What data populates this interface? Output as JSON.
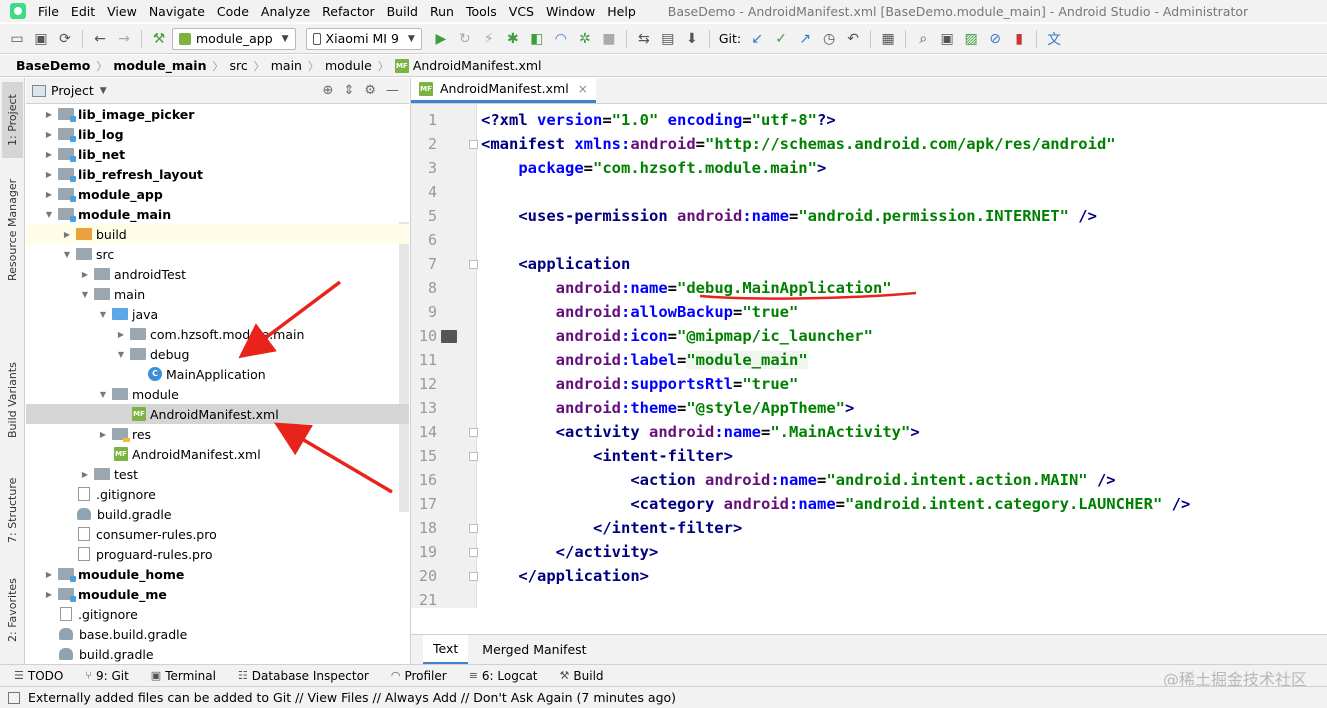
{
  "menu": [
    "File",
    "Edit",
    "View",
    "Navigate",
    "Code",
    "Analyze",
    "Refactor",
    "Build",
    "Run",
    "Tools",
    "VCS",
    "Window",
    "Help"
  ],
  "window_title": "BaseDemo - AndroidManifest.xml [BaseDemo.module_main] - Android Studio - Administrator",
  "toolbar": {
    "run_config": "module_app",
    "device": "Xiaomi MI 9",
    "git_label": "Git:"
  },
  "breadcrumb": [
    "BaseDemo",
    "module_main",
    "src",
    "main",
    "module",
    "AndroidManifest.xml"
  ],
  "left_stripe": [
    "1: Project",
    "Resource Manager",
    "Build Variants",
    "7: Structure",
    "2: Favorites"
  ],
  "project_panel": {
    "title": "Project"
  },
  "tree": [
    {
      "label": "lib_image_picker",
      "depth": 1,
      "icon": "module",
      "bold": true,
      "arrow": "right"
    },
    {
      "label": "lib_log",
      "depth": 1,
      "icon": "module",
      "bold": true,
      "arrow": "right"
    },
    {
      "label": "lib_net",
      "depth": 1,
      "icon": "module",
      "bold": true,
      "arrow": "right"
    },
    {
      "label": "lib_refresh_layout",
      "depth": 1,
      "icon": "module",
      "bold": true,
      "arrow": "right"
    },
    {
      "label": "module_app",
      "depth": 1,
      "icon": "module",
      "bold": true,
      "arrow": "right"
    },
    {
      "label": "module_main",
      "depth": 1,
      "icon": "module",
      "bold": true,
      "arrow": "down"
    },
    {
      "label": "build",
      "depth": 2,
      "icon": "folder-orange",
      "bold": false,
      "arrow": "right",
      "highlight": "yellow"
    },
    {
      "label": "src",
      "depth": 2,
      "icon": "folder",
      "bold": false,
      "arrow": "down"
    },
    {
      "label": "androidTest",
      "depth": 3,
      "icon": "folder",
      "bold": false,
      "arrow": "right"
    },
    {
      "label": "main",
      "depth": 3,
      "icon": "folder",
      "bold": false,
      "arrow": "down"
    },
    {
      "label": "java",
      "depth": 4,
      "icon": "folder-blue",
      "bold": false,
      "arrow": "down"
    },
    {
      "label": "com.hzsoft.module.main",
      "depth": 5,
      "icon": "folder",
      "bold": false,
      "arrow": "right"
    },
    {
      "label": "debug",
      "depth": 5,
      "icon": "folder",
      "bold": false,
      "arrow": "down"
    },
    {
      "label": "MainApplication",
      "depth": 6,
      "icon": "class",
      "bold": false,
      "arrow": ""
    },
    {
      "label": "module",
      "depth": 4,
      "icon": "folder",
      "bold": false,
      "arrow": "down"
    },
    {
      "label": "AndroidManifest.xml",
      "depth": 5,
      "icon": "manifest",
      "bold": false,
      "arrow": "",
      "highlight": "gray"
    },
    {
      "label": "res",
      "depth": 4,
      "icon": "folder-res",
      "bold": false,
      "arrow": "right"
    },
    {
      "label": "AndroidManifest.xml",
      "depth": 4,
      "icon": "manifest",
      "bold": false,
      "arrow": ""
    },
    {
      "label": "test",
      "depth": 3,
      "icon": "folder",
      "bold": false,
      "arrow": "right"
    },
    {
      "label": ".gitignore",
      "depth": 2,
      "icon": "file",
      "bold": false,
      "arrow": ""
    },
    {
      "label": "build.gradle",
      "depth": 2,
      "icon": "gradle",
      "bold": false,
      "arrow": ""
    },
    {
      "label": "consumer-rules.pro",
      "depth": 2,
      "icon": "file",
      "bold": false,
      "arrow": ""
    },
    {
      "label": "proguard-rules.pro",
      "depth": 2,
      "icon": "file",
      "bold": false,
      "arrow": ""
    },
    {
      "label": "moudule_home",
      "depth": 1,
      "icon": "module",
      "bold": true,
      "arrow": "right"
    },
    {
      "label": "moudule_me",
      "depth": 1,
      "icon": "module",
      "bold": true,
      "arrow": "right"
    },
    {
      "label": ".gitignore",
      "depth": 1,
      "icon": "file",
      "bold": false,
      "arrow": ""
    },
    {
      "label": "base.build.gradle",
      "depth": 1,
      "icon": "gradle",
      "bold": false,
      "arrow": ""
    },
    {
      "label": "build.gradle",
      "depth": 1,
      "icon": "gradle",
      "bold": false,
      "arrow": ""
    }
  ],
  "editor": {
    "tab": "AndroidManifest.xml",
    "lines": [
      [
        [
          "<?",
          "t"
        ],
        [
          "xml ",
          "t"
        ],
        [
          "version",
          "a"
        ],
        [
          "=",
          "p"
        ],
        [
          "\"1.0\" ",
          "v"
        ],
        [
          "encoding",
          "a"
        ],
        [
          "=",
          "p"
        ],
        [
          "\"utf-8\"",
          "v"
        ],
        [
          "?>",
          "t"
        ]
      ],
      [
        [
          "<",
          "t"
        ],
        [
          "manifest ",
          "t"
        ],
        [
          "xmlns:",
          "a"
        ],
        [
          "android",
          "ns"
        ],
        [
          "=",
          "p"
        ],
        [
          "\"http://schemas.android.com/apk/res/android\"",
          "v"
        ]
      ],
      [
        [
          "    ",
          "p"
        ],
        [
          "package",
          "a"
        ],
        [
          "=",
          "p"
        ],
        [
          "\"com.hzsoft.module.main\"",
          "v"
        ],
        [
          ">",
          "t"
        ]
      ],
      [],
      [
        [
          "    ",
          "p"
        ],
        [
          "<",
          "t"
        ],
        [
          "uses-permission ",
          "t"
        ],
        [
          "android",
          "ns"
        ],
        [
          ":",
          "a"
        ],
        [
          "name",
          "a"
        ],
        [
          "=",
          "p"
        ],
        [
          "\"android.permission.INTERNET\"",
          "v"
        ],
        [
          " />",
          "t"
        ]
      ],
      [],
      [
        [
          "    ",
          "p"
        ],
        [
          "<",
          "t"
        ],
        [
          "application",
          "t"
        ]
      ],
      [
        [
          "        ",
          "p"
        ],
        [
          "android",
          "ns"
        ],
        [
          ":",
          "a"
        ],
        [
          "name",
          "a"
        ],
        [
          "=",
          "p"
        ],
        [
          "\"debug.MainApplication\"",
          "v"
        ]
      ],
      [
        [
          "        ",
          "p"
        ],
        [
          "android",
          "ns"
        ],
        [
          ":",
          "a"
        ],
        [
          "allowBackup",
          "a"
        ],
        [
          "=",
          "p"
        ],
        [
          "\"true\"",
          "v"
        ]
      ],
      [
        [
          "        ",
          "p"
        ],
        [
          "android",
          "ns"
        ],
        [
          ":",
          "a"
        ],
        [
          "icon",
          "a"
        ],
        [
          "=",
          "p"
        ],
        [
          "\"@mipmap/ic_launcher\"",
          "v"
        ]
      ],
      [
        [
          "        ",
          "p"
        ],
        [
          "android",
          "ns"
        ],
        [
          ":",
          "a"
        ],
        [
          "label",
          "a"
        ],
        [
          "=",
          "p"
        ],
        [
          "\"module_main\"",
          "v-hl"
        ]
      ],
      [
        [
          "        ",
          "p"
        ],
        [
          "android",
          "ns"
        ],
        [
          ":",
          "a"
        ],
        [
          "supportsRtl",
          "a"
        ],
        [
          "=",
          "p"
        ],
        [
          "\"true\"",
          "v"
        ]
      ],
      [
        [
          "        ",
          "p"
        ],
        [
          "android",
          "ns"
        ],
        [
          ":",
          "a"
        ],
        [
          "theme",
          "a"
        ],
        [
          "=",
          "p"
        ],
        [
          "\"@style/AppTheme\"",
          "v"
        ],
        [
          ">",
          "t"
        ]
      ],
      [
        [
          "        ",
          "p"
        ],
        [
          "<",
          "t"
        ],
        [
          "activity ",
          "t"
        ],
        [
          "android",
          "ns"
        ],
        [
          ":",
          "a"
        ],
        [
          "name",
          "a"
        ],
        [
          "=",
          "p"
        ],
        [
          "\".MainActivity\"",
          "v"
        ],
        [
          ">",
          "t"
        ]
      ],
      [
        [
          "            ",
          "p"
        ],
        [
          "<",
          "t"
        ],
        [
          "intent-filter",
          "t"
        ],
        [
          ">",
          "t"
        ]
      ],
      [
        [
          "                ",
          "p"
        ],
        [
          "<",
          "t"
        ],
        [
          "action ",
          "t"
        ],
        [
          "android",
          "ns"
        ],
        [
          ":",
          "a"
        ],
        [
          "name",
          "a"
        ],
        [
          "=",
          "p"
        ],
        [
          "\"android.intent.action.MAIN\"",
          "v"
        ],
        [
          " />",
          "t"
        ]
      ],
      [
        [
          "                ",
          "p"
        ],
        [
          "<",
          "t"
        ],
        [
          "category ",
          "t"
        ],
        [
          "android",
          "ns"
        ],
        [
          ":",
          "a"
        ],
        [
          "name",
          "a"
        ],
        [
          "=",
          "p"
        ],
        [
          "\"android.intent.category.LAUNCHER\"",
          "v"
        ],
        [
          " />",
          "t"
        ]
      ],
      [
        [
          "            ",
          "p"
        ],
        [
          "</",
          "t"
        ],
        [
          "intent-filter",
          "t"
        ],
        [
          ">",
          "t"
        ]
      ],
      [
        [
          "        ",
          "p"
        ],
        [
          "</",
          "t"
        ],
        [
          "activity",
          "t"
        ],
        [
          ">",
          "t"
        ]
      ],
      [
        [
          "    ",
          "p"
        ],
        [
          "</",
          "t"
        ],
        [
          "application",
          "t"
        ],
        [
          ">",
          "t"
        ]
      ],
      []
    ],
    "bottom_tabs": [
      "Text",
      "Merged Manifest"
    ]
  },
  "tool_windows": [
    "TODO",
    "9: Git",
    "Terminal",
    "Database Inspector",
    "Profiler",
    "6: Logcat",
    "Build"
  ],
  "status": "Externally added files can be added to Git // View Files // Always Add // Don't Ask Again (7 minutes ago)",
  "watermark": "@稀土掘金技术社区",
  "colors": {
    "accent": "#4083c9",
    "tag": "#000080",
    "attr": "#0000ff",
    "namespace": "#660e7a",
    "value": "#008000",
    "annotation": "#e8231b"
  }
}
